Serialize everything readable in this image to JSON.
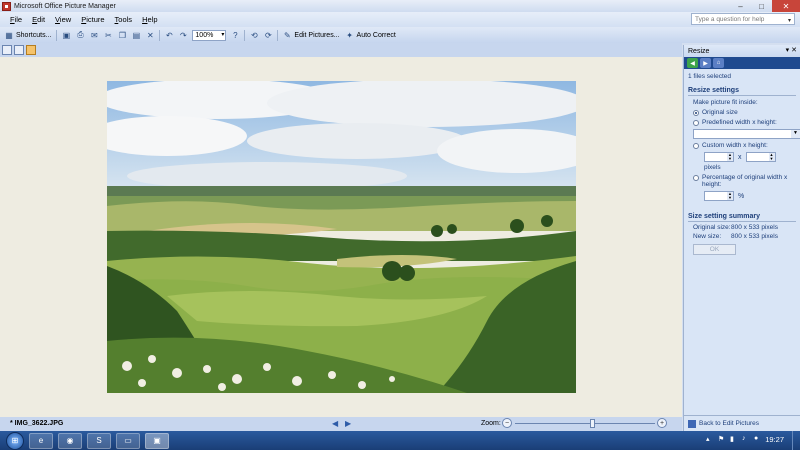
{
  "window": {
    "title": "Microsoft Office Picture Manager"
  },
  "menu": {
    "items": [
      "File",
      "Edit",
      "View",
      "Picture",
      "Tools",
      "Help"
    ],
    "help_placeholder": "Type a question for help"
  },
  "toolbar": {
    "shortcuts_label": "Shortcuts...",
    "zoom_value": "100%",
    "edit_pictures_label": "Edit Pictures...",
    "auto_correct_label": "Auto Correct"
  },
  "status": {
    "file_name": "* IMG_3622.JPG",
    "zoom_label": "Zoom:",
    "zoom_level": 0.55
  },
  "pane": {
    "title": "Resize",
    "files_selected": "1 files selected",
    "resize_settings_title": "Resize settings",
    "make_fit_label": "Make picture fit inside:",
    "options": {
      "original": "Original size",
      "predefined": "Predefined width x height:",
      "custom": "Custom width x height:",
      "percentage": "Percentage of original width x height:"
    },
    "x_label": "x",
    "pixels_label": "pixels",
    "percent_label": "%",
    "summary_title": "Size setting summary",
    "original_size_key": "Original size:",
    "original_size_val": "800 x 533 pixels",
    "new_size_key": "New size:",
    "new_size_val": "800 x 533 pixels",
    "ok_label": "OK",
    "back_label": "Back to Edit Pictures"
  },
  "taskbar": {
    "time": "19:27"
  },
  "colors": {
    "accent": "#1f4a8f",
    "pane_bg": "#d9e5f6",
    "canvas_bg": "#eeece1"
  }
}
